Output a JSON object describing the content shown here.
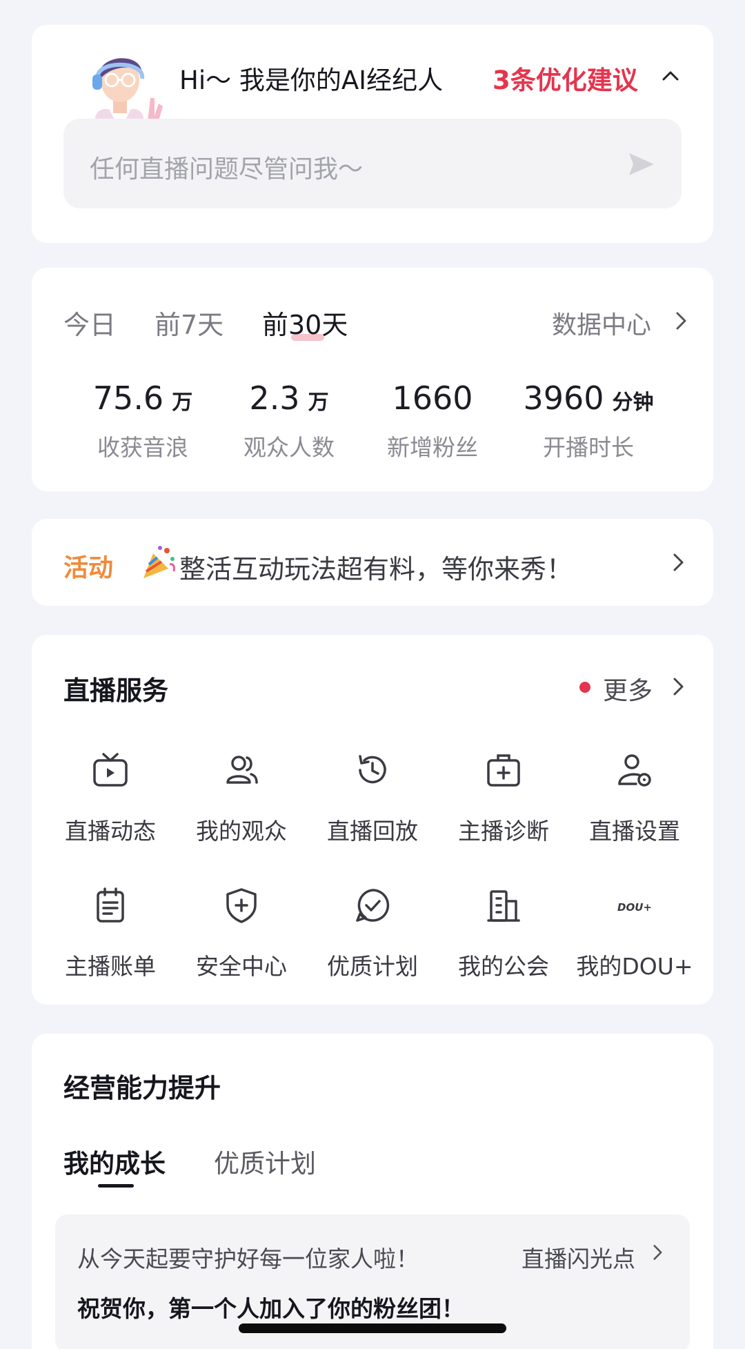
{
  "agent": {
    "greeting": "Hi～ 我是你的AI经纪人",
    "suggestions": "3条优化建议",
    "ask_placeholder": "任何直播问题尽管问我～"
  },
  "stats": {
    "tabs": [
      "今日",
      "前7天",
      "前30天"
    ],
    "active_tab": "前30天",
    "data_center": "数据中心",
    "items": [
      {
        "value": "75.6",
        "unit": "万",
        "label": "收获音浪"
      },
      {
        "value": "2.3",
        "unit": "万",
        "label": "观众人数"
      },
      {
        "value": "1660",
        "unit": "",
        "label": "新增粉丝"
      },
      {
        "value": "3960",
        "unit": "分钟",
        "label": "开播时长"
      }
    ]
  },
  "activity": {
    "tag": "活动",
    "text": "整活互动玩法超有料，等你来秀！"
  },
  "services": {
    "title": "直播服务",
    "more": "更多",
    "items": [
      {
        "label": "直播动态",
        "icon": "tv-play-icon"
      },
      {
        "label": "我的观众",
        "icon": "users-icon"
      },
      {
        "label": "直播回放",
        "icon": "history-icon"
      },
      {
        "label": "主播诊断",
        "icon": "medical-kit-icon"
      },
      {
        "label": "直播设置",
        "icon": "user-settings-icon"
      },
      {
        "label": "主播账单",
        "icon": "bill-icon"
      },
      {
        "label": "安全中心",
        "icon": "shield-plus-icon"
      },
      {
        "label": "优质计划",
        "icon": "check-badge-icon"
      },
      {
        "label": "我的公会",
        "icon": "building-icon"
      },
      {
        "label": "我的DOU+",
        "icon": "dou-plus-icon",
        "icon_text": "DOU+"
      }
    ]
  },
  "growth": {
    "title": "经营能力提升",
    "tabs": [
      "我的成长",
      "优质计划"
    ],
    "active_tab": "我的成长",
    "line1": "从今天起要守护好每一位家人啦！",
    "link": "直播闪光点",
    "line2": "祝贺你，第一个人加入了你的粉丝团！"
  },
  "colors": {
    "accent_red": "#e5344e",
    "activity_orange": "#f08a3a",
    "background": "#f3f4f9"
  }
}
